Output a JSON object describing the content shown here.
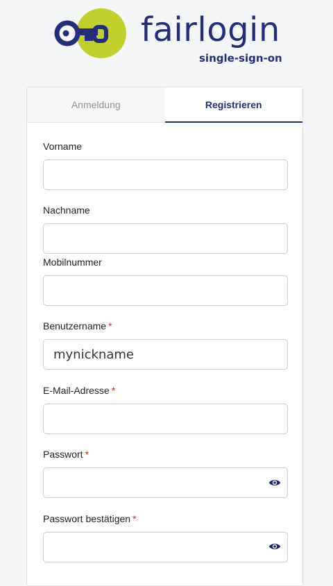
{
  "brand": {
    "name": "fairlogin",
    "tagline": "single-sign-on"
  },
  "tabs": [
    {
      "label": "Anmeldung",
      "active": false
    },
    {
      "label": "Registrieren",
      "active": true
    }
  ],
  "form": {
    "fields": {
      "first_name": {
        "label": "Vorname",
        "value": ""
      },
      "last_name": {
        "label": "Nachname",
        "value": ""
      },
      "mobile": {
        "label": "Mobilnummer",
        "value": ""
      },
      "username": {
        "label": "Benutzername",
        "required_marker": "*",
        "value": "mynickname"
      },
      "email": {
        "label": "E-Mail-Adresse",
        "required_marker": "*",
        "value": ""
      },
      "password": {
        "label": "Passwort",
        "required_marker": "*",
        "value": ""
      },
      "password_confirm": {
        "label": "Passwort bestätigen",
        "required_marker": "*",
        "value": ""
      }
    }
  },
  "icons": {
    "logo_mark": "key-icon",
    "password_toggle": "eye-icon"
  },
  "colors": {
    "brand_navy": "#252d7a",
    "brand_lime": "#c2d02e",
    "required": "#c62828"
  }
}
